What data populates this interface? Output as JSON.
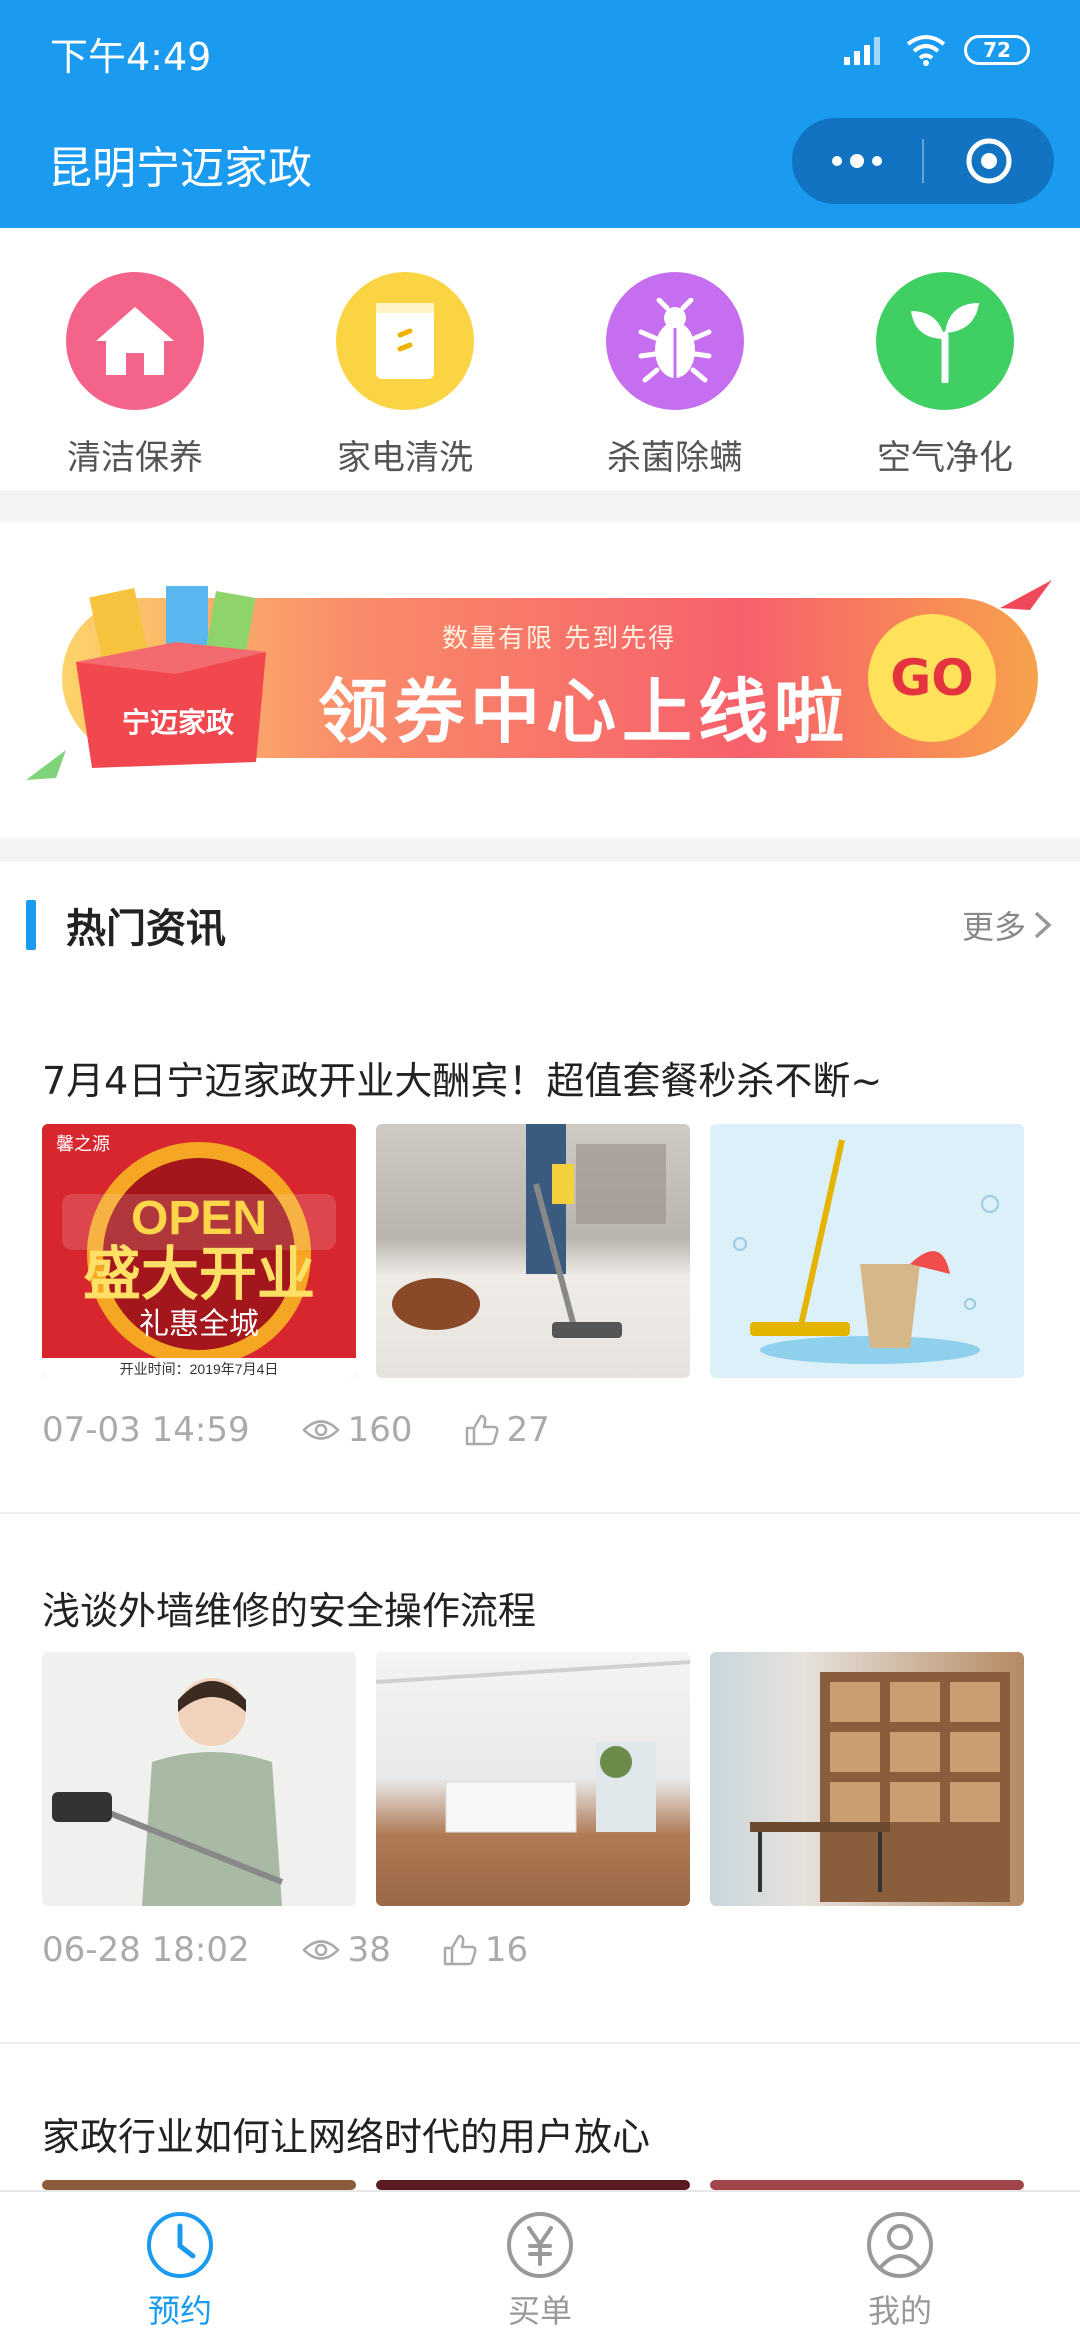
{
  "status": {
    "time": "下午4:49",
    "battery": "72"
  },
  "header": {
    "title": "昆明宁迈家政",
    "more_icon": "ellipsis-icon",
    "close_icon": "target-icon"
  },
  "categories": [
    {
      "label": "清洁保养",
      "icon": "house-icon",
      "color": "#f4648a"
    },
    {
      "label": "家电清洗",
      "icon": "appliance-icon",
      "color": "#fbd443"
    },
    {
      "label": "杀菌除螨",
      "icon": "bug-icon",
      "color": "#c56ef0"
    },
    {
      "label": "空气净化",
      "icon": "sprout-icon",
      "color": "#3fcf63"
    }
  ],
  "banner": {
    "subtitle": "数量有限 先到先得",
    "title": "领券中心上线啦",
    "go": "GO",
    "box_label": "宁迈家政"
  },
  "section": {
    "title": "热门资讯",
    "more": "更多"
  },
  "articles": [
    {
      "title": "7月4日宁迈家政开业大酬宾！超值套餐秒杀不断~",
      "date": "07-03 14:59",
      "views": "160",
      "likes": "27",
      "thumb1_text": "OPEN",
      "thumb1_title": "盛大开业",
      "thumb1_sub": "礼惠全城",
      "thumb1_brand": "馨之源",
      "thumb1_footer": "开业时间：2019年7月4日"
    },
    {
      "title": "浅谈外墙维修的安全操作流程",
      "date": "06-28 18:02",
      "views": "38",
      "likes": "16"
    },
    {
      "title": "家政行业如何让网络时代的用户放心"
    }
  ],
  "tabs": [
    {
      "label": "预约",
      "icon": "clock-icon",
      "active": true
    },
    {
      "label": "买单",
      "icon": "yen-icon",
      "active": false
    },
    {
      "label": "我的",
      "icon": "user-icon",
      "active": false
    }
  ],
  "colors": {
    "primary": "#1a9bf0",
    "capsule": "#1173c2",
    "banner_go": "#ffe25a"
  }
}
